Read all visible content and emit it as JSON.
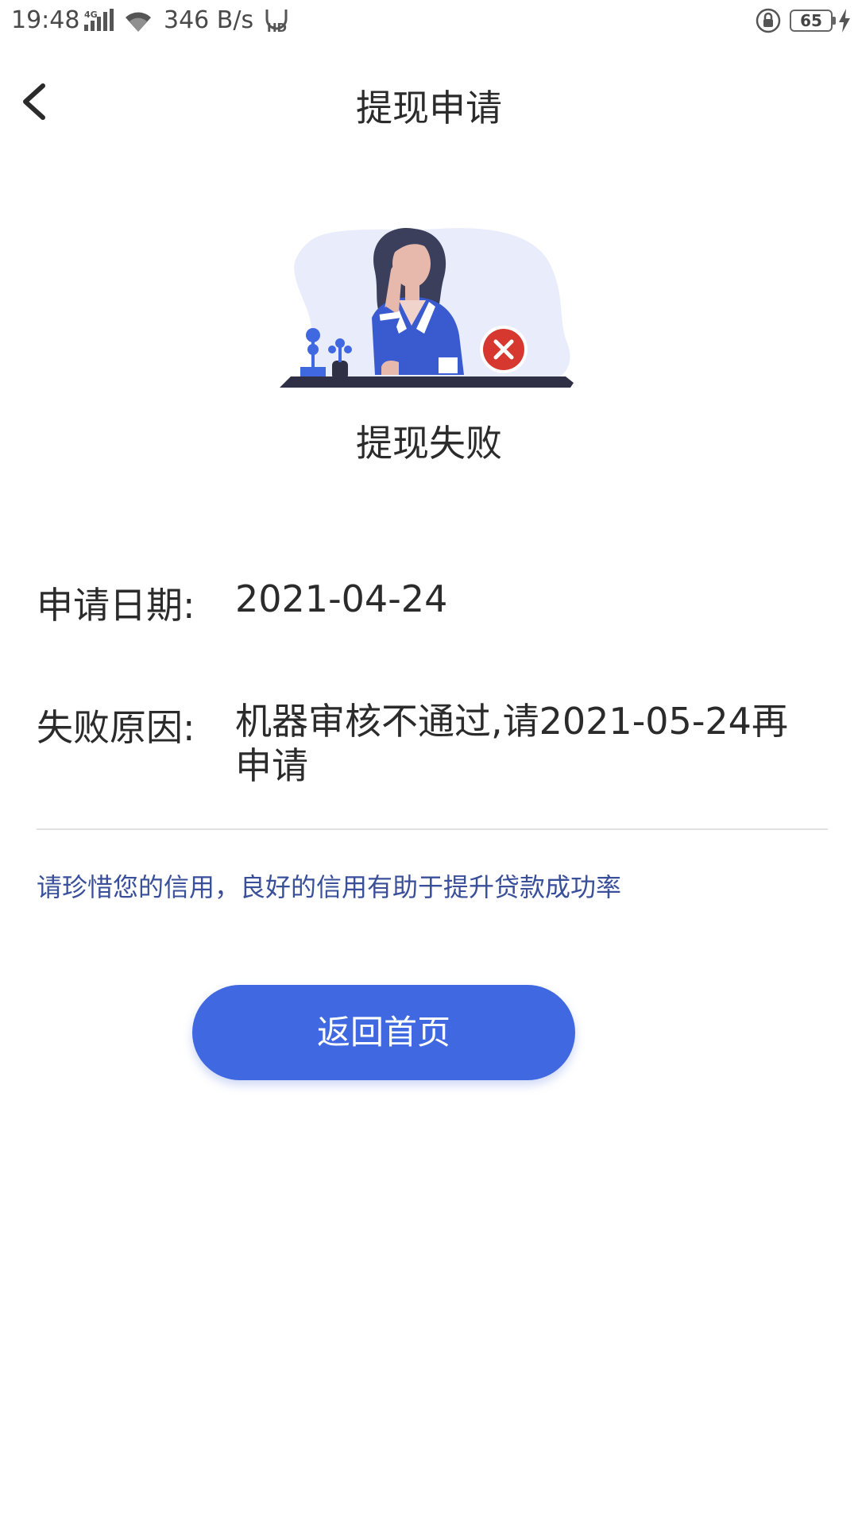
{
  "status_bar": {
    "time": "19:48",
    "network_icon": "signal-4g-icon",
    "wifi_icon": "wifi-icon",
    "speed": "346 B/s",
    "hd_icon": "hd-icon",
    "lock_icon": "rotation-lock-icon",
    "battery_level": "65",
    "charge_icon": "charging-bolt-icon"
  },
  "header": {
    "back_icon": "chevron-left-icon",
    "title": "提现申请"
  },
  "result": {
    "illustration_icon": "woman-at-desk-failure-illustration",
    "status_icon": "close-circle-icon",
    "title": "提现失败"
  },
  "details": {
    "date_label": "申请日期:",
    "date_value": "2021-04-24",
    "reason_label": "失败原因:",
    "reason_value": "机器审核不通过,请2021-05-24再申请"
  },
  "tip": "请珍惜您的信用，良好的信用有助于提升贷款成功率",
  "actions": {
    "home_label": "返回首页"
  },
  "colors": {
    "primary": "#4068e0",
    "tip_text": "#3a4f9a",
    "error_badge": "#d6382f",
    "illustration_bg": "#e9ecfa",
    "desk": "#2f3045"
  }
}
